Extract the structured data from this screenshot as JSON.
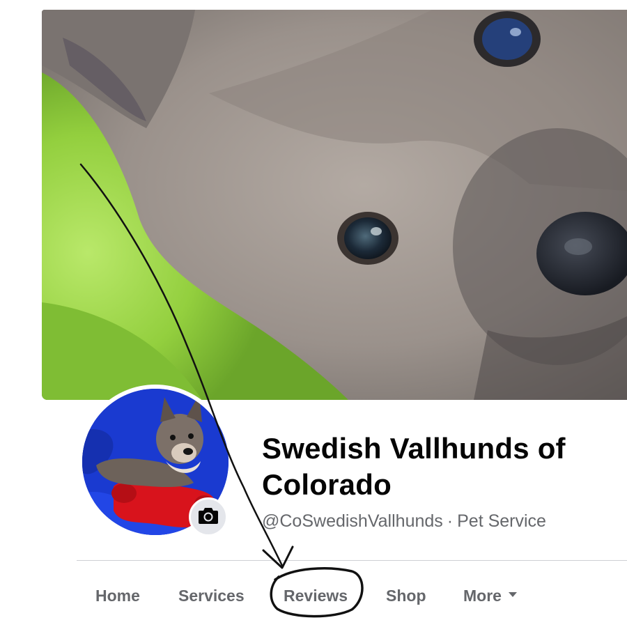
{
  "page": {
    "name": "Swedish Vallhunds of Colorado",
    "handle": "@CoSwedishVallhunds",
    "separator": "·",
    "category": "Pet Service"
  },
  "tabs": [
    {
      "label": "Home"
    },
    {
      "label": "Services"
    },
    {
      "label": "Reviews"
    },
    {
      "label": "Shop"
    },
    {
      "label": "More"
    }
  ],
  "icons": {
    "camera": "camera-icon",
    "more_caret": "caret-down-icon"
  },
  "colors": {
    "text_primary": "#050505",
    "text_secondary": "#65676b",
    "divider": "#ced0d4",
    "camera_bg": "#e4e6eb",
    "annotation_ink": "#111111"
  }
}
